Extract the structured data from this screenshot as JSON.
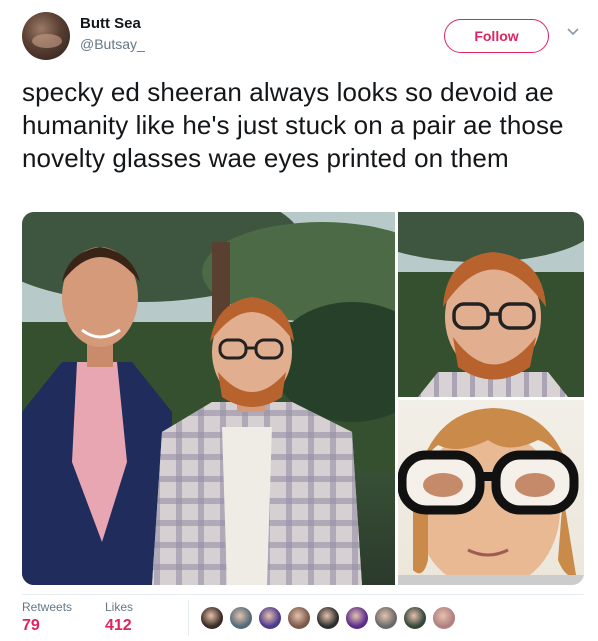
{
  "author": {
    "name": "Butt Sea",
    "handle": "@Butsay_"
  },
  "actions": {
    "follow_label": "Follow",
    "more_icon": "chevron-down-icon"
  },
  "tweet": {
    "text": "specky ed sheeran always looks so devoid ae humanity like he's just stuck on a pair ae those novelty glasses wae eyes printed on them"
  },
  "stats": {
    "retweets_label": "Retweets",
    "retweets_value": "79",
    "likes_label": "Likes",
    "likes_value": "412"
  },
  "liker_avatars": [
    {
      "color": "#3b2a25"
    },
    {
      "color": "#556b7a"
    },
    {
      "color": "#4b3a8c"
    },
    {
      "color": "#7a5a4a"
    },
    {
      "color": "#2d2d2d"
    },
    {
      "color": "#5a2d8c"
    },
    {
      "color": "#6a6a6a"
    },
    {
      "color": "#34463a"
    },
    {
      "color": "#b08080"
    }
  ],
  "colors": {
    "accent": "#e0245e",
    "secondary_text": "#657786"
  }
}
